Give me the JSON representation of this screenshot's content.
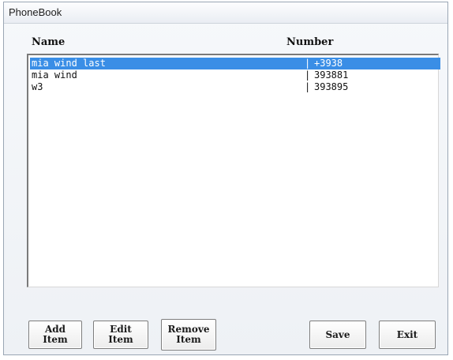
{
  "window": {
    "title": "PhoneBook"
  },
  "list": {
    "columns": {
      "name": "Name",
      "number": "Number"
    },
    "separator": "|",
    "rows": [
      {
        "name": "mia wind last",
        "number": "+3938"
      },
      {
        "name": "mia wind",
        "number": "393881"
      },
      {
        "name": "w3",
        "number": "393895"
      }
    ],
    "selected_index": 0
  },
  "buttons": {
    "add": "Add Item",
    "edit": "Edit Item",
    "remove": "Remove Item",
    "save": "Save",
    "exit": "Exit"
  },
  "colors": {
    "selection": "#3a8ee6",
    "window_bg": "#f0f0f0"
  }
}
